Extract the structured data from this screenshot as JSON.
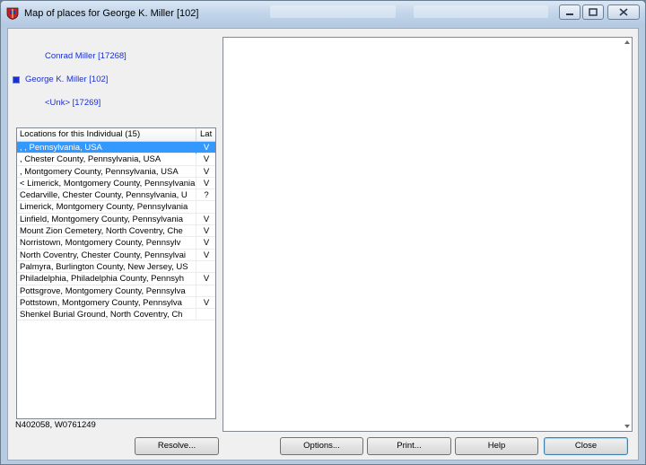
{
  "window": {
    "title": "Map of places for George K. Miller [102]"
  },
  "family": {
    "father": "Conrad Miller [17268]",
    "self": "George K. Miller [102]",
    "mother": "<Unk> [17269]"
  },
  "locations": {
    "header_name": "Locations for this Individual (15)",
    "header_lat": "Lat",
    "rows": [
      {
        "name": ", , Pennsylvania, USA",
        "lat": "V",
        "selected": true
      },
      {
        "name": ", Chester County, Pennsylvania, USA",
        "lat": "V"
      },
      {
        "name": ", Montgomery County, Pennsylvania, USA",
        "lat": "V"
      },
      {
        "name": "< Limerick, Montgomery County, Pennsylvania",
        "lat": "V"
      },
      {
        "name": "Cedarville, Chester County, Pennsylvania, U",
        "lat": "?"
      },
      {
        "name": "Limerick, Montgomery County, Pennsylvania",
        "lat": ""
      },
      {
        "name": "Linfield, Montgomery County, Pennsylvania",
        "lat": "V"
      },
      {
        "name": "Mount Zion Cemetery, North Coventry, Che",
        "lat": "V"
      },
      {
        "name": "Norristown, Montgomery County, Pennsylv",
        "lat": "V"
      },
      {
        "name": "North Coventry, Chester County, Pennsylvai",
        "lat": "V"
      },
      {
        "name": "Palmyra, Burlington County, New Jersey, US",
        "lat": ""
      },
      {
        "name": "Philadelphia, Philadelphia County, Pennsyh",
        "lat": "V"
      },
      {
        "name": "Pottsgrove, Montgomery County, Pennsylva",
        "lat": ""
      },
      {
        "name": "Pottstown, Montgomery County, Pennsylva",
        "lat": "V"
      },
      {
        "name": "Shenkel Burial Ground, North Coventry, Ch",
        "lat": ""
      }
    ]
  },
  "coordinates": "N402058, W0761249",
  "buttons": {
    "resolve": "Resolve...",
    "options": "Options...",
    "print": "Print...",
    "help": "Help",
    "close": "Close"
  },
  "colors": {
    "link": "#1a2fd0",
    "selection": "#3399ff"
  }
}
